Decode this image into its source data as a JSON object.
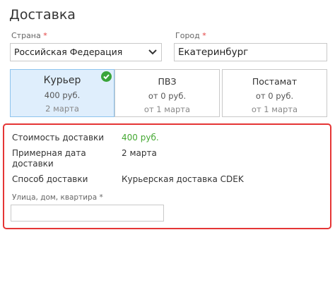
{
  "header": {
    "title": "Доставка"
  },
  "country": {
    "label": "Страна",
    "required_mark": "*",
    "value": "Российская Федерация"
  },
  "city": {
    "label": "Город",
    "required_mark": "*",
    "value": "Екатеринбург"
  },
  "options": [
    {
      "name": "Курьер",
      "price": "400 руб.",
      "date": "2 марта",
      "selected": true
    },
    {
      "name": "ПВЗ",
      "price": "от 0 руб.",
      "date": "от 1 марта",
      "selected": false
    },
    {
      "name": "Постамат",
      "price": "от 0 руб.",
      "date": "от 1 марта",
      "selected": false
    }
  ],
  "summary": {
    "cost_label": "Стоимость доставки",
    "cost_value": "400 руб.",
    "date_label": "Примерная дата доставки",
    "date_value": "2 марта",
    "method_label": "Способ доставки",
    "method_value": "Курьерская доставка CDEK",
    "street_label": "Улица, дом, квартира",
    "street_required_mark": "*",
    "street_value": ""
  },
  "colors": {
    "accent_green": "#44a832",
    "selected_bg": "#dfeefc",
    "highlight_border": "#e53535"
  },
  "icons": {
    "check": "check-circle-icon",
    "dropdown": "chevron-down-icon"
  }
}
